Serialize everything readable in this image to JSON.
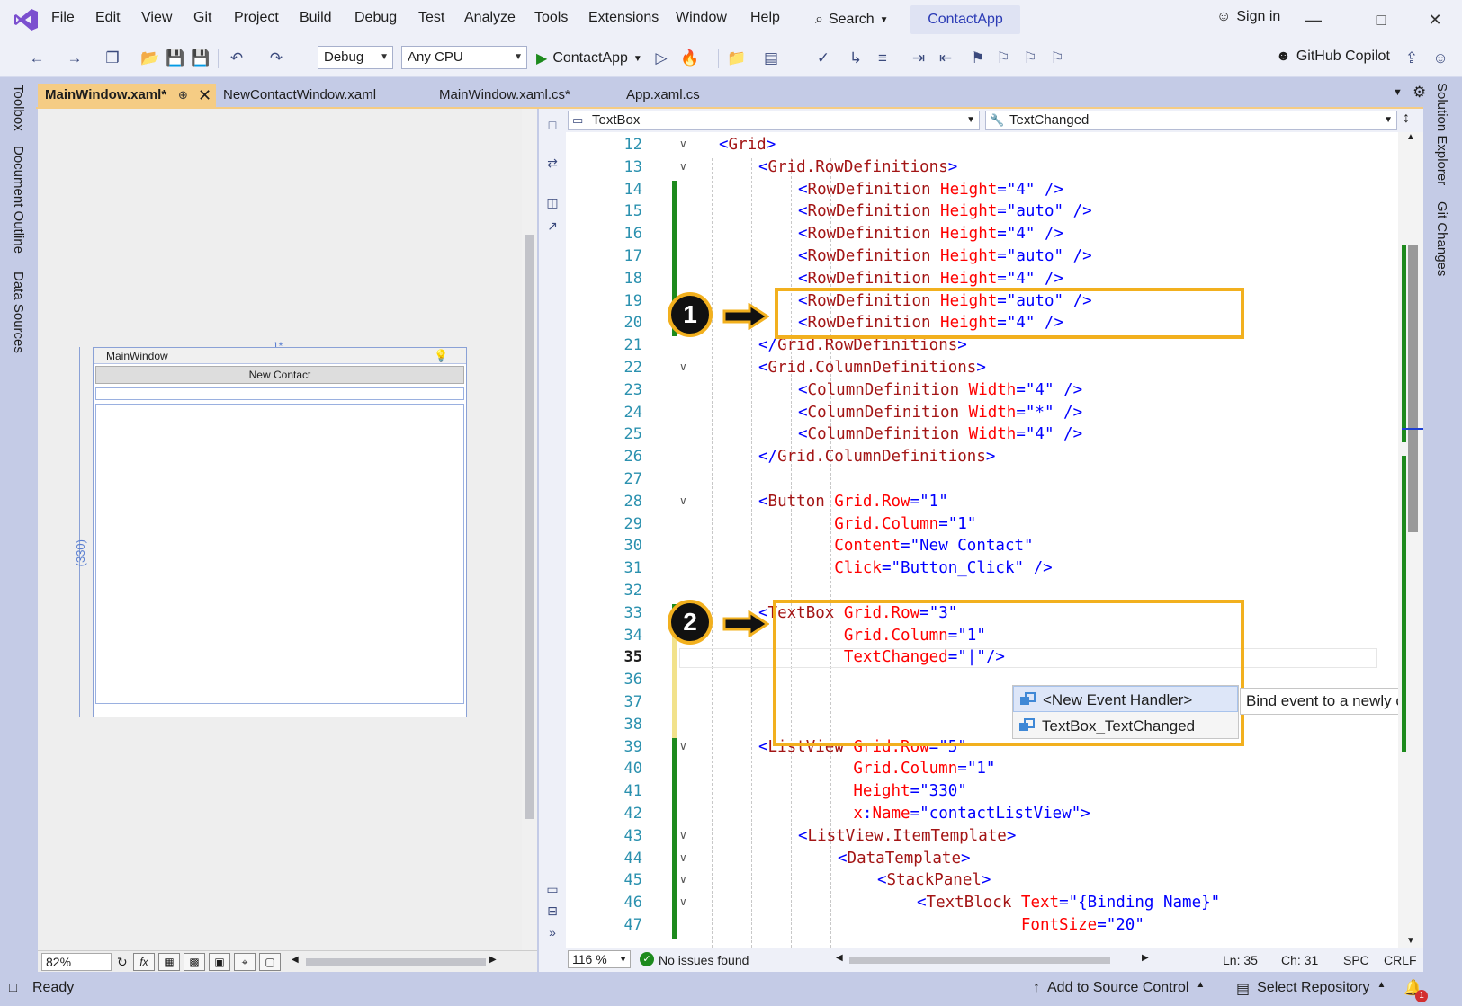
{
  "menu": {
    "items": [
      "File",
      "Edit",
      "View",
      "Git",
      "Project",
      "Build",
      "Debug",
      "Test",
      "Analyze",
      "Tools",
      "Extensions",
      "Window",
      "Help"
    ],
    "search_label": "Search",
    "solution_name": "ContactApp",
    "sign_in_label": "Sign in"
  },
  "toolbar": {
    "configuration": "Debug",
    "platform": "Any CPU",
    "run_target": "ContactApp",
    "copilot_label": "GitHub Copilot"
  },
  "side_tabs": {
    "left": [
      "Toolbox",
      "Document Outline",
      "Data Sources"
    ],
    "right": [
      "Solution Explorer",
      "Git Changes"
    ]
  },
  "doc_tabs": [
    {
      "label": "MainWindow.xaml*",
      "active": true
    },
    {
      "label": "NewContactWindow.xaml",
      "active": false
    },
    {
      "label": "MainWindow.xaml.cs*",
      "active": false
    },
    {
      "label": "App.xaml.cs",
      "active": false
    }
  ],
  "designer": {
    "window_title": "MainWindow",
    "button_content": "New Contact",
    "star_size": "1*",
    "listview_height": "(330)",
    "zoom": "82%"
  },
  "nav": {
    "element": "TextBox",
    "event": "TextChanged"
  },
  "code_lines": [
    {
      "n": "12",
      "indent": 0,
      "parts": [
        [
          "p",
          "<"
        ],
        [
          "t",
          "Grid"
        ],
        [
          "p",
          ">"
        ]
      ]
    },
    {
      "n": "13",
      "indent": 1,
      "parts": [
        [
          "p",
          "<"
        ],
        [
          "t",
          "Grid.RowDefinitions"
        ],
        [
          "p",
          ">"
        ]
      ]
    },
    {
      "n": "14",
      "indent": 2,
      "parts": [
        [
          "p",
          "<"
        ],
        [
          "t",
          "RowDefinition"
        ],
        [
          "a",
          " Height"
        ],
        [
          "p",
          "="
        ],
        [
          "v",
          "\"4\""
        ],
        [
          "p",
          " />"
        ]
      ]
    },
    {
      "n": "15",
      "indent": 2,
      "parts": [
        [
          "p",
          "<"
        ],
        [
          "t",
          "RowDefinition"
        ],
        [
          "a",
          " Height"
        ],
        [
          "p",
          "="
        ],
        [
          "v",
          "\"auto\""
        ],
        [
          "p",
          " />"
        ]
      ]
    },
    {
      "n": "16",
      "indent": 2,
      "parts": [
        [
          "p",
          "<"
        ],
        [
          "t",
          "RowDefinition"
        ],
        [
          "a",
          " Height"
        ],
        [
          "p",
          "="
        ],
        [
          "v",
          "\"4\""
        ],
        [
          "p",
          " />"
        ]
      ]
    },
    {
      "n": "17",
      "indent": 2,
      "parts": [
        [
          "p",
          "<"
        ],
        [
          "t",
          "RowDefinition"
        ],
        [
          "a",
          " Height"
        ],
        [
          "p",
          "="
        ],
        [
          "v",
          "\"auto\""
        ],
        [
          "p",
          " />"
        ]
      ]
    },
    {
      "n": "18",
      "indent": 2,
      "parts": [
        [
          "p",
          "<"
        ],
        [
          "t",
          "RowDefinition"
        ],
        [
          "a",
          " Height"
        ],
        [
          "p",
          "="
        ],
        [
          "v",
          "\"4\""
        ],
        [
          "p",
          " />"
        ]
      ]
    },
    {
      "n": "19",
      "indent": 2,
      "parts": [
        [
          "p",
          "<"
        ],
        [
          "t",
          "RowDefinition"
        ],
        [
          "a",
          " Height"
        ],
        [
          "p",
          "="
        ],
        [
          "v",
          "\"auto\""
        ],
        [
          "p",
          " />"
        ]
      ]
    },
    {
      "n": "20",
      "indent": 2,
      "parts": [
        [
          "p",
          "<"
        ],
        [
          "t",
          "RowDefinition"
        ],
        [
          "a",
          " Height"
        ],
        [
          "p",
          "="
        ],
        [
          "v",
          "\"4\""
        ],
        [
          "p",
          " />"
        ]
      ]
    },
    {
      "n": "21",
      "indent": 1,
      "parts": [
        [
          "p",
          "</"
        ],
        [
          "t",
          "Grid.RowDefinitions"
        ],
        [
          "p",
          ">"
        ]
      ]
    },
    {
      "n": "22",
      "indent": 1,
      "parts": [
        [
          "p",
          "<"
        ],
        [
          "t",
          "Grid.ColumnDefinitions"
        ],
        [
          "p",
          ">"
        ]
      ]
    },
    {
      "n": "23",
      "indent": 2,
      "parts": [
        [
          "p",
          "<"
        ],
        [
          "t",
          "ColumnDefinition"
        ],
        [
          "a",
          " Width"
        ],
        [
          "p",
          "="
        ],
        [
          "v",
          "\"4\""
        ],
        [
          "p",
          " />"
        ]
      ]
    },
    {
      "n": "24",
      "indent": 2,
      "parts": [
        [
          "p",
          "<"
        ],
        [
          "t",
          "ColumnDefinition"
        ],
        [
          "a",
          " Width"
        ],
        [
          "p",
          "="
        ],
        [
          "v",
          "\"*\""
        ],
        [
          "p",
          " />"
        ]
      ]
    },
    {
      "n": "25",
      "indent": 2,
      "parts": [
        [
          "p",
          "<"
        ],
        [
          "t",
          "ColumnDefinition"
        ],
        [
          "a",
          " Width"
        ],
        [
          "p",
          "="
        ],
        [
          "v",
          "\"4\""
        ],
        [
          "p",
          " />"
        ]
      ]
    },
    {
      "n": "26",
      "indent": 1,
      "parts": [
        [
          "p",
          "</"
        ],
        [
          "t",
          "Grid.ColumnDefinitions"
        ],
        [
          "p",
          ">"
        ]
      ]
    },
    {
      "n": "27",
      "indent": 0,
      "parts": []
    },
    {
      "n": "28",
      "indent": 1,
      "parts": [
        [
          "p",
          "<"
        ],
        [
          "t",
          "Button"
        ],
        [
          "a",
          " Grid.Row"
        ],
        [
          "p",
          "="
        ],
        [
          "v",
          "\"1\""
        ]
      ]
    },
    {
      "n": "29",
      "indent": 1,
      "parts": [
        [
          "a",
          "        Grid.Column"
        ],
        [
          "p",
          "="
        ],
        [
          "v",
          "\"1\""
        ]
      ]
    },
    {
      "n": "30",
      "indent": 1,
      "parts": [
        [
          "a",
          "        Content"
        ],
        [
          "p",
          "="
        ],
        [
          "v",
          "\"New Contact\""
        ]
      ]
    },
    {
      "n": "31",
      "indent": 1,
      "parts": [
        [
          "a",
          "        Click"
        ],
        [
          "p",
          "="
        ],
        [
          "v",
          "\"Button_Click\""
        ],
        [
          "p",
          " />"
        ]
      ]
    },
    {
      "n": "32",
      "indent": 0,
      "parts": []
    },
    {
      "n": "33",
      "indent": 1,
      "parts": [
        [
          "p",
          "<"
        ],
        [
          "t",
          "TextBox"
        ],
        [
          "a",
          " Grid.Row"
        ],
        [
          "p",
          "="
        ],
        [
          "v",
          "\"3\""
        ]
      ]
    },
    {
      "n": "34",
      "indent": 1,
      "parts": [
        [
          "a",
          "         Grid.Column"
        ],
        [
          "p",
          "="
        ],
        [
          "v",
          "\"1\""
        ]
      ]
    },
    {
      "n": "35",
      "indent": 1,
      "parts": [
        [
          "a",
          "         TextChanged"
        ],
        [
          "p",
          "="
        ],
        [
          "v",
          "\"|\""
        ],
        [
          "p",
          "/>"
        ]
      ]
    },
    {
      "n": "36",
      "indent": 0,
      "parts": []
    },
    {
      "n": "37",
      "indent": 0,
      "parts": []
    },
    {
      "n": "38",
      "indent": 0,
      "parts": []
    },
    {
      "n": "39",
      "indent": 1,
      "parts": [
        [
          "p",
          "<"
        ],
        [
          "t",
          "ListView"
        ],
        [
          "a",
          " Grid.Row"
        ],
        [
          "p",
          "="
        ],
        [
          "v",
          "\"5\""
        ]
      ]
    },
    {
      "n": "40",
      "indent": 1,
      "parts": [
        [
          "a",
          "          Grid.Column"
        ],
        [
          "p",
          "="
        ],
        [
          "v",
          "\"1\""
        ]
      ]
    },
    {
      "n": "41",
      "indent": 1,
      "parts": [
        [
          "a",
          "          Height"
        ],
        [
          "p",
          "="
        ],
        [
          "v",
          "\"330\""
        ]
      ]
    },
    {
      "n": "42",
      "indent": 1,
      "parts": [
        [
          "a",
          "          x"
        ],
        [
          "p",
          ":"
        ],
        [
          "a",
          "Name"
        ],
        [
          "p",
          "="
        ],
        [
          "v",
          "\"contactListView\""
        ],
        [
          "p",
          ">"
        ]
      ]
    },
    {
      "n": "43",
      "indent": 2,
      "parts": [
        [
          "p",
          "<"
        ],
        [
          "t",
          "ListView.ItemTemplate"
        ],
        [
          "p",
          ">"
        ]
      ]
    },
    {
      "n": "44",
      "indent": 3,
      "parts": [
        [
          "p",
          "<"
        ],
        [
          "t",
          "DataTemplate"
        ],
        [
          "p",
          ">"
        ]
      ]
    },
    {
      "n": "45",
      "indent": 4,
      "parts": [
        [
          "p",
          "<"
        ],
        [
          "t",
          "StackPanel"
        ],
        [
          "p",
          ">"
        ]
      ]
    },
    {
      "n": "46",
      "indent": 5,
      "parts": [
        [
          "p",
          "<"
        ],
        [
          "t",
          "TextBlock"
        ],
        [
          "a",
          " Text"
        ],
        [
          "p",
          "="
        ],
        [
          "v",
          "\"{Binding Name}\""
        ]
      ]
    },
    {
      "n": "47",
      "indent": 5,
      "parts": [
        [
          "a",
          "           FontSize"
        ],
        [
          "p",
          "="
        ],
        [
          "v",
          "\"20\""
        ]
      ]
    }
  ],
  "current_line": "35",
  "callouts": [
    "1",
    "2"
  ],
  "intellisense": {
    "items": [
      "<New Event Handler>",
      "TextBox_TextChanged"
    ],
    "tooltip": "Bind event to a newly created m"
  },
  "editor_status": {
    "zoom": "116 %",
    "issues": "No issues found",
    "line": "Ln: 35",
    "col": "Ch: 31",
    "spc": "SPC",
    "eol": "CRLF"
  },
  "statusbar": {
    "ready": "Ready",
    "source_control": "Add to Source Control",
    "repository": "Select Repository",
    "notifications": "1"
  },
  "colors": {
    "accent": "#f2b01e",
    "tab_active": "#f5cc84",
    "chrome": "#c4cbe6",
    "change_bar": "#1d8a1d"
  }
}
